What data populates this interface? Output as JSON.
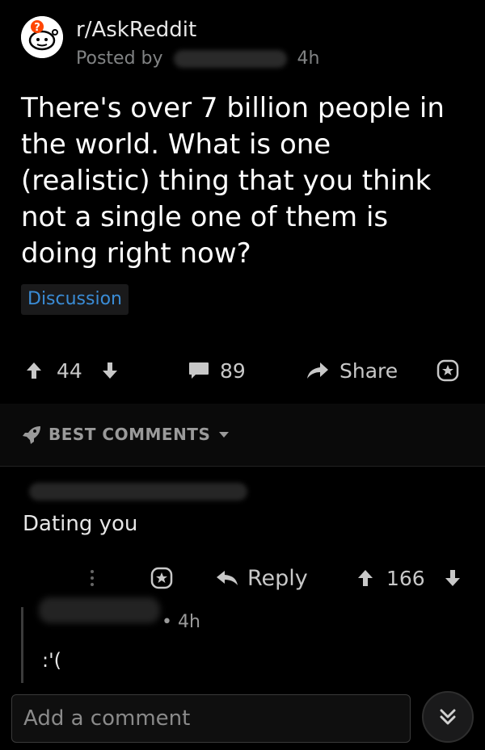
{
  "post": {
    "subreddit": "r/AskReddit",
    "posted_by_label": "Posted by",
    "time": "4h",
    "title": "There's over 7 billion people in the world. What is one (realistic) thing that you think not a single one of them is doing right now?",
    "flair": "Discussion"
  },
  "actions": {
    "upvotes": "44",
    "comments": "89",
    "share_label": "Share"
  },
  "sort": {
    "label": "BEST COMMENTS"
  },
  "comments": [
    {
      "text": "Dating you",
      "reply_label": "Reply",
      "score": "166"
    },
    {
      "time": "• 4h",
      "text": ":'("
    }
  ],
  "composer": {
    "placeholder": "Add a comment"
  },
  "colors": {
    "background": "#000000",
    "flair_text": "#3a8cd6",
    "muted": "#818384"
  }
}
